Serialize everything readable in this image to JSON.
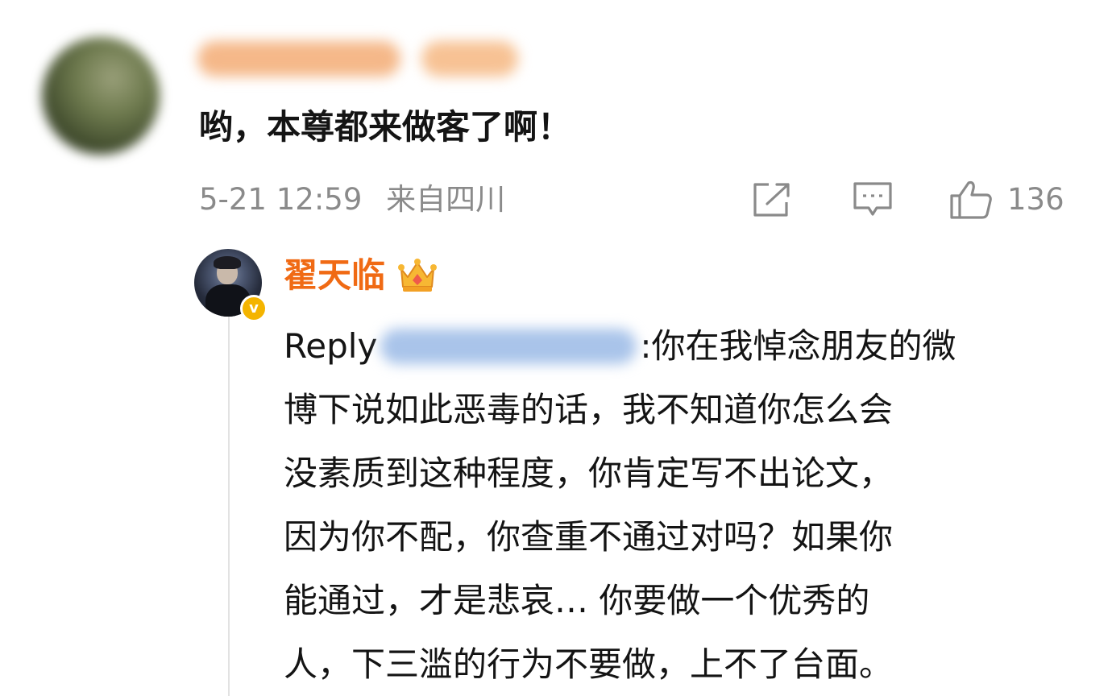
{
  "comment": {
    "text": "哟，本尊都来做客了啊！",
    "date": "5-21 12:59",
    "location": "来自四川",
    "like_count": "136",
    "icons": [
      "share-icon",
      "comment-icon",
      "thumbs-up-icon"
    ]
  },
  "reply": {
    "username": "翟天临",
    "prefix": "Reply",
    "colon": ":",
    "lines": [
      "你在我悼念朋友的微",
      "博下说如此恶毒的话，我不知道你怎么会",
      "没素质到这种程度，你肯定写不出论文，",
      "因为你不配，你查重不通过对吗？如果你",
      "能通过，才是悲哀… 你要做一个优秀的",
      "人，下三滥的行为不要做，上不了台面。"
    ],
    "icons": [
      "crown-icon",
      "verified-badge-icon"
    ]
  },
  "colors": {
    "reply_username": "#f06a14",
    "meta_gray": "#8a8a8a",
    "verified_badge": "#f4b400"
  }
}
